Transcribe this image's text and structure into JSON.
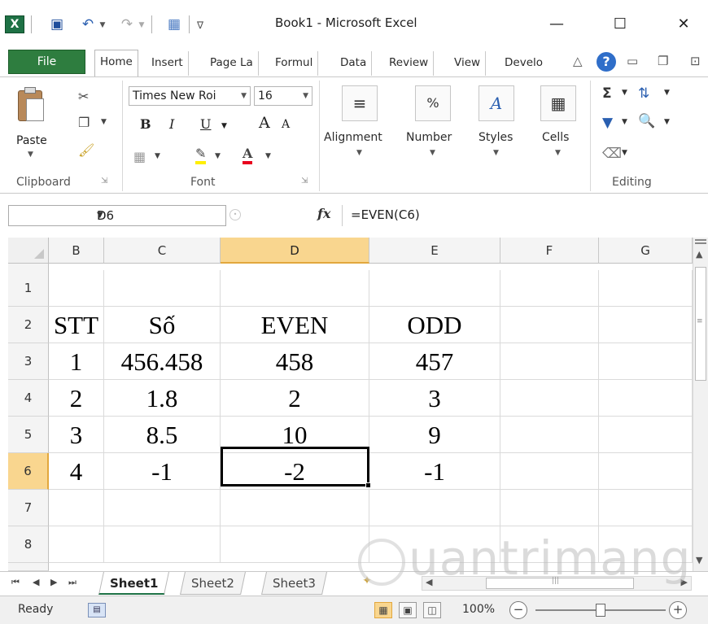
{
  "titlebar": {
    "title": "Book1  -  Microsoft Excel",
    "app_icon_label": "X",
    "icons": [
      "excel-logo-icon",
      "save-icon",
      "undo-icon",
      "redo-icon",
      "calculator-icon",
      "customize-quick-access-icon"
    ]
  },
  "ribbon_tabs": [
    {
      "label": "File"
    },
    {
      "label": "Home"
    },
    {
      "label": "Insert"
    },
    {
      "label": "Page La"
    },
    {
      "label": "Formul"
    },
    {
      "label": "Data"
    },
    {
      "label": "Review"
    },
    {
      "label": "View"
    },
    {
      "label": "Develo"
    }
  ],
  "active_tab": "Home",
  "ribbon": {
    "clipboard": {
      "paste_label": "Paste",
      "group_label": "Clipboard"
    },
    "font": {
      "font_name": "Times New Roi",
      "font_size": "16",
      "bold": "B",
      "italic": "I",
      "underline": "U",
      "grow": "A",
      "shrink": "A",
      "color_a": "A",
      "group_label": "Font"
    },
    "alignment_label": "Alignment",
    "number_label": "Number",
    "number_symbol": "%",
    "styles_label": "Styles",
    "cells_label": "Cells",
    "editing": {
      "sum": "Σ",
      "group_label": "Editing"
    }
  },
  "formula_bar": {
    "name_box": "D6",
    "fx": "fx",
    "formula": "=EVEN(C6)"
  },
  "grid": {
    "columns": [
      "B",
      "C",
      "D",
      "E",
      "F",
      "G"
    ],
    "selected_column": "D",
    "rows": [
      "1",
      "2",
      "3",
      "4",
      "5",
      "6",
      "7",
      "8"
    ],
    "selected_row": "6",
    "cells": {
      "r1": [
        "",
        "",
        "",
        "",
        "",
        ""
      ],
      "r2": [
        "STT",
        "Số",
        "EVEN",
        "ODD",
        "",
        ""
      ],
      "r3": [
        "1",
        "456.458",
        "458",
        "457",
        "",
        ""
      ],
      "r4": [
        "2",
        "1.8",
        "2",
        "3",
        "",
        ""
      ],
      "r5": [
        "3",
        "8.5",
        "10",
        "9",
        "",
        ""
      ],
      "r6": [
        "4",
        "-1",
        "-2",
        "-1",
        "",
        ""
      ],
      "r7": [
        "",
        "",
        "",
        "",
        "",
        ""
      ],
      "r8": [
        "",
        "",
        "",
        "",
        "",
        ""
      ]
    }
  },
  "sheets": [
    {
      "label": "Sheet1"
    },
    {
      "label": "Sheet2"
    },
    {
      "label": "Sheet3"
    }
  ],
  "active_sheet": "Sheet1",
  "status": {
    "ready": "Ready",
    "zoom": "100%",
    "zoom_out": "−",
    "zoom_in": "+"
  },
  "watermark": {
    "text": "uantrimang"
  }
}
